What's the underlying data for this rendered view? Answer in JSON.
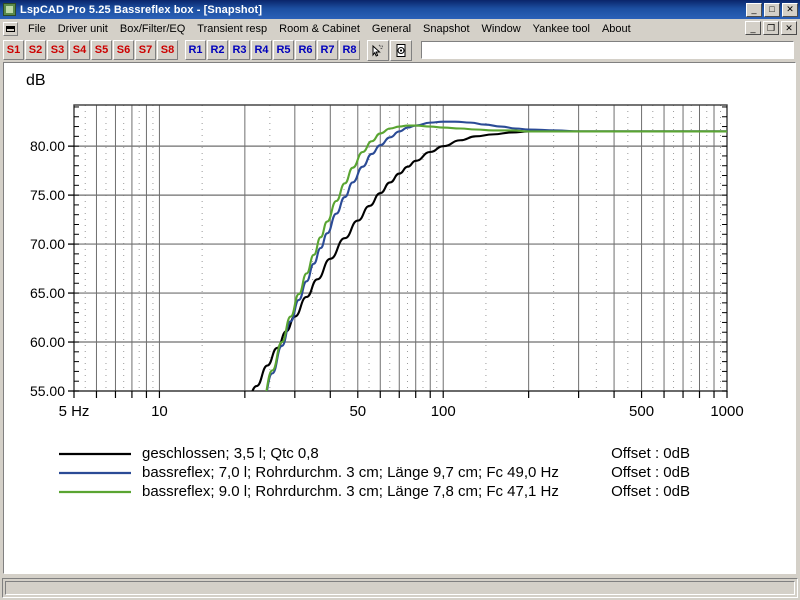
{
  "window": {
    "title": "LspCAD Pro 5.25 Bassreflex box - [Snapshot]",
    "app_icon": "app-icon",
    "controls": {
      "minimize": "_",
      "maximize": "□",
      "close": "✕",
      "mdi_restore": "❐"
    }
  },
  "menu": {
    "system_icon": "mdi-system-icon",
    "items": [
      {
        "label": "File"
      },
      {
        "label": "Driver unit"
      },
      {
        "label": "Box/Filter/EQ"
      },
      {
        "label": "Transient resp"
      },
      {
        "label": "Room & Cabinet"
      },
      {
        "label": "General"
      },
      {
        "label": "Snapshot"
      },
      {
        "label": "Window"
      },
      {
        "label": "Yankee tool"
      },
      {
        "label": "About"
      }
    ]
  },
  "toolbar": {
    "snapshot_buttons": [
      "S1",
      "S2",
      "S3",
      "S4",
      "S5",
      "S6",
      "S7",
      "S8"
    ],
    "recall_buttons": [
      "R1",
      "R2",
      "R3",
      "R4",
      "R5",
      "R6",
      "R7",
      "R8"
    ],
    "icon_buttons": [
      {
        "name": "cursor-pick-icon"
      },
      {
        "name": "driver-unit-icon"
      }
    ],
    "text_field_value": ""
  },
  "statusbar": {
    "text": ""
  },
  "chart_data": {
    "type": "line",
    "title": "",
    "ylabel": "dB",
    "xlabel": "",
    "xscale": "log",
    "xlim": [
      5,
      1000
    ],
    "ylim": [
      55.0,
      84.2
    ],
    "grid": true,
    "x_ticks": [
      {
        "value": 5,
        "label": "5 Hz"
      },
      {
        "value": 10,
        "label": "10"
      },
      {
        "value": 50,
        "label": "50"
      },
      {
        "value": 100,
        "label": "100"
      },
      {
        "value": 500,
        "label": "500"
      },
      {
        "value": 1000,
        "label": "1000"
      }
    ],
    "x_gridlines": [
      5,
      6,
      7,
      8,
      9,
      10,
      20,
      30,
      40,
      50,
      60,
      70,
      80,
      90,
      100,
      200,
      300,
      400,
      500,
      600,
      700,
      800,
      900,
      1000
    ],
    "y_ticks": [
      {
        "value": 80.0,
        "label": "80.00"
      },
      {
        "value": 75.0,
        "label": "75.00"
      },
      {
        "value": 70.0,
        "label": "70.00"
      },
      {
        "value": 65.0,
        "label": "65.00"
      },
      {
        "value": 60.0,
        "label": "60.00"
      },
      {
        "value": 55.0,
        "label": "55.00"
      }
    ],
    "series": [
      {
        "name": "geschlossen; 3,5 l; Qtc 0,8",
        "color": "#000000",
        "legend_label": "geschlossen; 3,5 l; Qtc 0,8",
        "offset_label": "Offset : 0dB",
        "points": [
          [
            18.0,
            51.0
          ],
          [
            20.0,
            53.3
          ],
          [
            22.0,
            55.5
          ],
          [
            24.0,
            57.6
          ],
          [
            26.0,
            59.4
          ],
          [
            28.0,
            61.1
          ],
          [
            30.0,
            62.6
          ],
          [
            33.0,
            64.6
          ],
          [
            36.0,
            66.4
          ],
          [
            40.0,
            68.5
          ],
          [
            45.0,
            70.6
          ],
          [
            50.0,
            72.4
          ],
          [
            55.0,
            73.9
          ],
          [
            60.0,
            75.2
          ],
          [
            65.0,
            76.3
          ],
          [
            70.0,
            77.2
          ],
          [
            75.0,
            77.9
          ],
          [
            80.0,
            78.5
          ],
          [
            90.0,
            79.4
          ],
          [
            100.0,
            80.0
          ],
          [
            115.0,
            80.6
          ],
          [
            130.0,
            81.0
          ],
          [
            150.0,
            81.2
          ],
          [
            175.0,
            81.4
          ],
          [
            200.0,
            81.5
          ],
          [
            250.0,
            81.5
          ],
          [
            300.0,
            81.5
          ],
          [
            400.0,
            81.5
          ],
          [
            500.0,
            81.5
          ],
          [
            700.0,
            81.5
          ],
          [
            1000.0,
            81.5
          ]
        ]
      },
      {
        "name": "bassreflex; 7,0 l; Rohrdurchm. 3 cm; Länge 9,7 cm; Fc 49,0 Hz",
        "color": "#2b4b96",
        "legend_label": "bassreflex; 7,0 l; Rohrdurchm. 3 cm; Länge 9,7 cm; Fc 49,0 Hz",
        "offset_label": "Offset : 0dB",
        "points": [
          [
            21.0,
            50.0
          ],
          [
            23.0,
            53.5
          ],
          [
            25.0,
            56.8
          ],
          [
            27.0,
            59.6
          ],
          [
            29.0,
            62.1
          ],
          [
            31.0,
            64.3
          ],
          [
            33.0,
            66.2
          ],
          [
            35.0,
            68.0
          ],
          [
            37.0,
            69.6
          ],
          [
            39.0,
            71.1
          ],
          [
            42.0,
            73.1
          ],
          [
            45.0,
            74.8
          ],
          [
            48.0,
            76.3
          ],
          [
            52.0,
            77.9
          ],
          [
            56.0,
            79.2
          ],
          [
            60.0,
            80.1
          ],
          [
            65.0,
            80.9
          ],
          [
            70.0,
            81.5
          ],
          [
            75.0,
            81.9
          ],
          [
            80.0,
            82.1
          ],
          [
            90.0,
            82.4
          ],
          [
            100.0,
            82.5
          ],
          [
            110.0,
            82.5
          ],
          [
            125.0,
            82.4
          ],
          [
            140.0,
            82.2
          ],
          [
            160.0,
            82.0
          ],
          [
            180.0,
            81.8
          ],
          [
            200.0,
            81.7
          ],
          [
            250.0,
            81.6
          ],
          [
            300.0,
            81.5
          ],
          [
            400.0,
            81.5
          ],
          [
            500.0,
            81.5
          ],
          [
            700.0,
            81.5
          ],
          [
            1000.0,
            81.5
          ]
        ]
      },
      {
        "name": "bassreflex; 9,0 l; Rohrdurchm. 3 cm; Länge 7,8 cm; Fc 47,1 Hz",
        "color": "#5aa532",
        "legend_label": "bassreflex; 9.0 l; Rohrdurchm. 3 cm; Länge 7,8 cm; Fc 47,1 Hz",
        "offset_label": "Offset : 0dB",
        "points": [
          [
            21.0,
            50.2
          ],
          [
            23.0,
            53.8
          ],
          [
            25.0,
            57.1
          ],
          [
            27.0,
            60.0
          ],
          [
            29.0,
            62.6
          ],
          [
            31.0,
            64.9
          ],
          [
            33.0,
            67.0
          ],
          [
            35.0,
            68.9
          ],
          [
            37.0,
            70.7
          ],
          [
            39.0,
            72.3
          ],
          [
            42.0,
            74.4
          ],
          [
            45.0,
            76.2
          ],
          [
            48.0,
            77.8
          ],
          [
            52.0,
            79.4
          ],
          [
            56.0,
            80.5
          ],
          [
            60.0,
            81.3
          ],
          [
            65.0,
            81.8
          ],
          [
            70.0,
            82.0
          ],
          [
            75.0,
            82.1
          ],
          [
            80.0,
            82.1
          ],
          [
            90.0,
            82.0
          ],
          [
            100.0,
            81.9
          ],
          [
            115.0,
            81.8
          ],
          [
            130.0,
            81.7
          ],
          [
            150.0,
            81.6
          ],
          [
            175.0,
            81.6
          ],
          [
            200.0,
            81.5
          ],
          [
            250.0,
            81.5
          ],
          [
            300.0,
            81.5
          ],
          [
            400.0,
            81.5
          ],
          [
            500.0,
            81.5
          ],
          [
            700.0,
            81.5
          ],
          [
            1000.0,
            81.5
          ]
        ]
      }
    ],
    "legend": {
      "position": "bottom-left",
      "entries": [
        {
          "label": "geschlossen; 3,5 l; Qtc 0,8",
          "offset": "Offset : 0dB",
          "color": "#000000"
        },
        {
          "label": "bassreflex; 7,0 l; Rohrdurchm. 3 cm; Länge 9,7 cm; Fc 49,0 Hz",
          "offset": "Offset : 0dB",
          "color": "#2b4b96"
        },
        {
          "label": "bassreflex; 9.0 l; Rohrdurchm. 3 cm; Länge 7,8 cm; Fc 47,1 Hz",
          "offset": "Offset : 0dB",
          "color": "#5aa532"
        }
      ]
    }
  }
}
